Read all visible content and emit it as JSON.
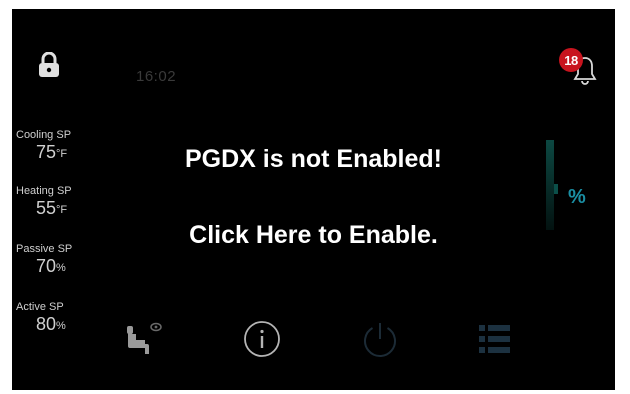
{
  "status": {
    "time": "16:02",
    "notification_count": "18"
  },
  "setpoints": [
    {
      "label": "Cooling SP",
      "value": "75",
      "unit": "°F"
    },
    {
      "label": "Heating SP",
      "value": "55",
      "unit": "°F"
    },
    {
      "label": "Passive SP",
      "value": "70",
      "unit": "%"
    },
    {
      "label": "Active SP",
      "value": "80",
      "unit": "%"
    }
  ],
  "right_panel": {
    "unit": "%"
  },
  "overlay": {
    "message": "PGDX is not Enabled!",
    "action": "Click Here to Enable."
  },
  "icons": {
    "lock": "lock-icon",
    "bell": "bell-icon",
    "seat": "seat-icon",
    "info": "info-icon",
    "power": "power-icon",
    "menu": "menu-icon"
  },
  "colors": {
    "background": "#000000",
    "badge": "#c8141e",
    "accent_teal": "#1a8ea3",
    "text": "#ffffff"
  }
}
